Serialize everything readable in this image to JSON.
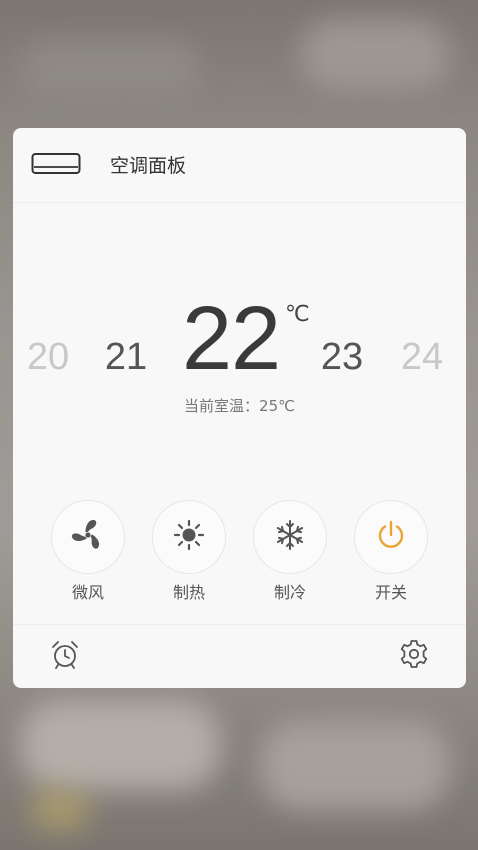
{
  "panel": {
    "title": "空调面板"
  },
  "temperature": {
    "options": [
      "20",
      "21",
      "22",
      "23",
      "24"
    ],
    "selected": "22",
    "unit": "℃"
  },
  "room": {
    "label": "当前室温：",
    "value": "25℃"
  },
  "controls": [
    {
      "label": "微风",
      "icon": "fan-icon"
    },
    {
      "label": "制热",
      "icon": "sun-icon"
    },
    {
      "label": "制冷",
      "icon": "snowflake-icon"
    },
    {
      "label": "开关",
      "icon": "power-icon",
      "color": "#e8a435"
    }
  ],
  "footer": {
    "left_icon": "alarm-clock-icon",
    "right_icon": "gear-icon"
  }
}
